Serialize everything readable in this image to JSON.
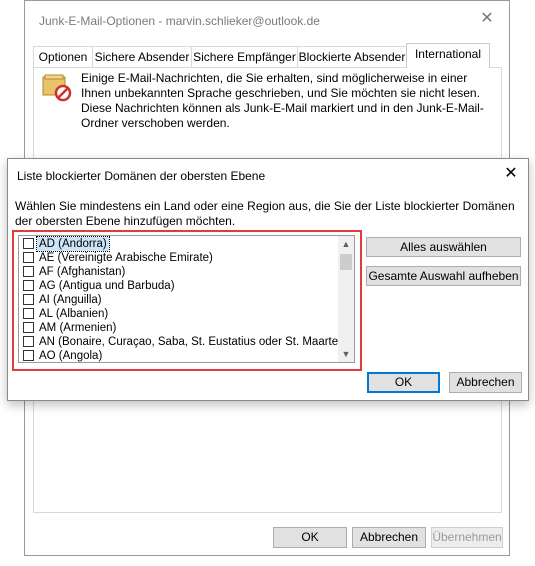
{
  "back_window": {
    "title": "Junk-E-Mail-Optionen - marvin.schlieker@outlook.de",
    "tabs": [
      {
        "label": "Optionen"
      },
      {
        "label": "Sichere Absender"
      },
      {
        "label": "Sichere Empfänger"
      },
      {
        "label": "Blockierte Absender"
      },
      {
        "label": "International"
      }
    ],
    "active_tab": "International",
    "info_text": "Einige E-Mail-Nachrichten, die Sie erhalten, sind möglicherweise in einer Ihnen unbekannten Sprache geschrieben, und Sie möchten sie nicht lesen. Diese Nachrichten können als Junk-E-Mail markiert und in den Junk-E-Mail-Ordner verschoben werden.",
    "buttons": {
      "ok": "OK",
      "cancel": "Abbrechen",
      "apply": "Übernehmen"
    }
  },
  "dialog": {
    "title": "Liste blockierter Domänen der obersten Ebene",
    "instruction": "Wählen Sie mindestens ein Land oder eine Region aus, die Sie der Liste blockierter Domänen der obersten Ebene hinzufügen möchten.",
    "items": [
      {
        "label": "AD (Andorra)",
        "checked": false,
        "selected": true
      },
      {
        "label": "AE (Vereinigte Arabische Emirate)",
        "checked": false
      },
      {
        "label": "AF (Afghanistan)",
        "checked": false
      },
      {
        "label": "AG (Antigua und Barbuda)",
        "checked": false
      },
      {
        "label": "AI (Anguilla)",
        "checked": false
      },
      {
        "label": "AL (Albanien)",
        "checked": false
      },
      {
        "label": "AM (Armenien)",
        "checked": false
      },
      {
        "label": "AN (Bonaire, Curaçao, Saba, St. Eustatius oder St. Maarten)",
        "checked": false
      },
      {
        "label": "AO (Angola)",
        "checked": false
      }
    ],
    "buttons": {
      "select_all": "Alles auswählen",
      "clear_all": "Gesamte Auswahl aufheben",
      "ok": "OK",
      "cancel": "Abbrechen"
    }
  },
  "colors": {
    "highlight_border": "#e03c3c",
    "selection_bg": "#cce4f7",
    "default_button_border": "#0078d7"
  }
}
